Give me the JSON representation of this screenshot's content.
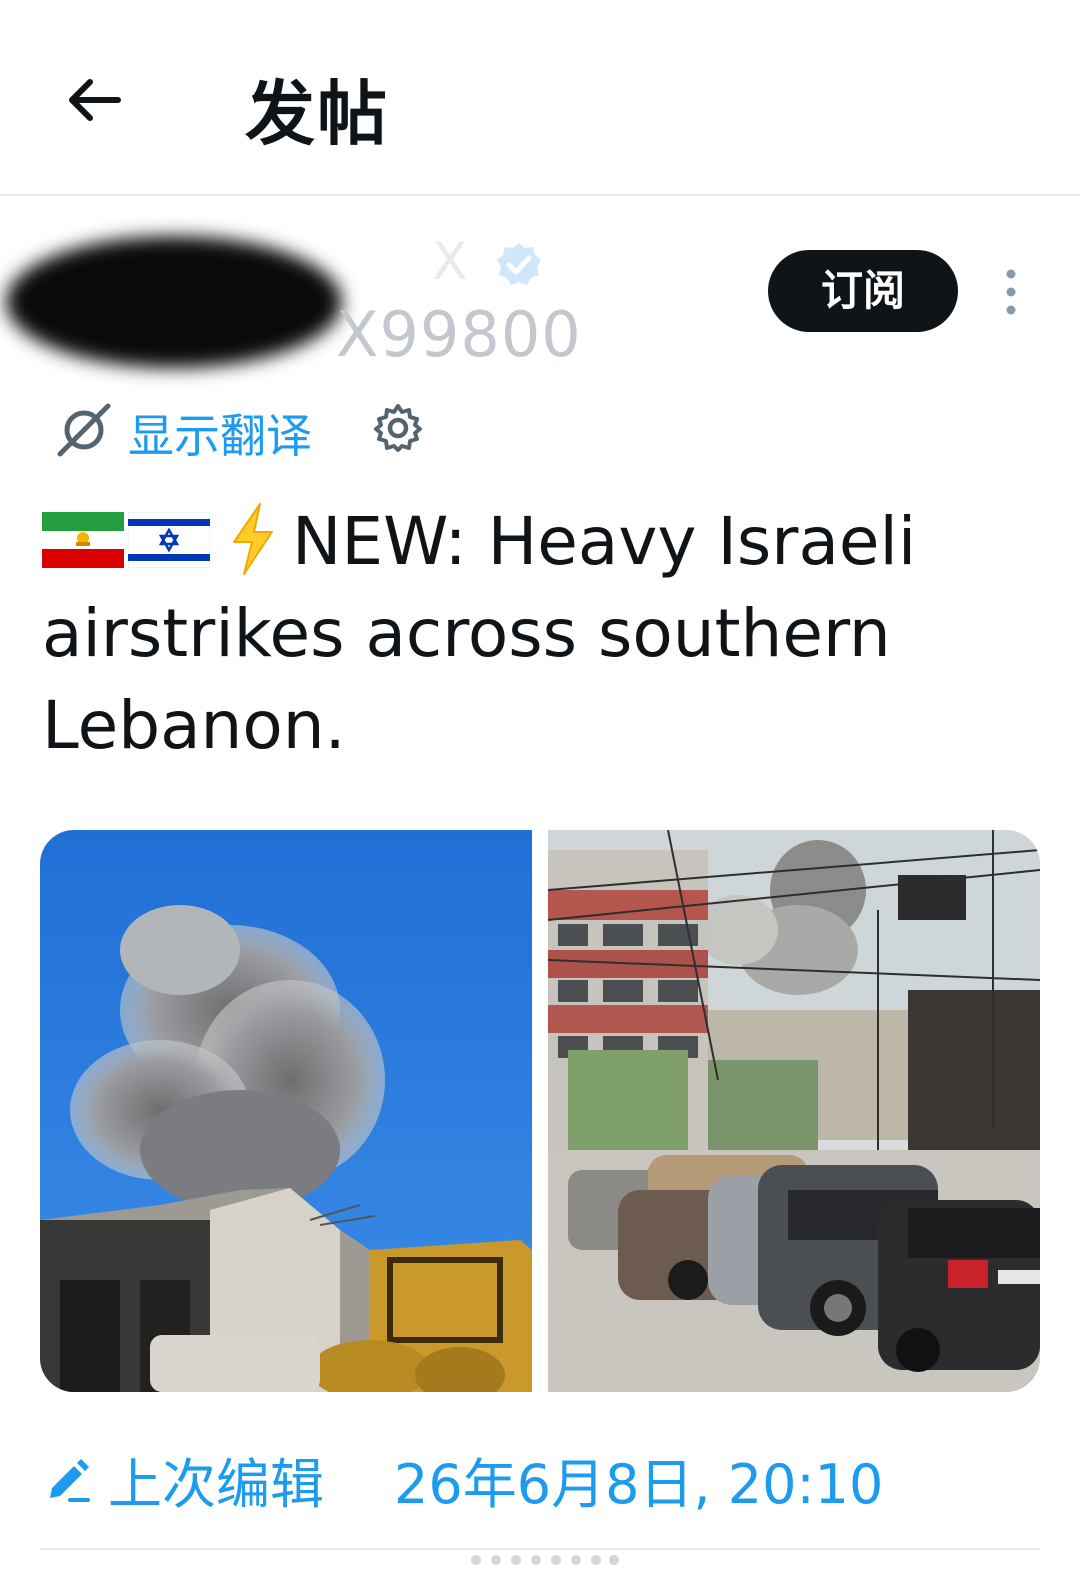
{
  "header": {
    "title": "发帖"
  },
  "author": {
    "name_visible_fragment": "X",
    "handle_fragment": "X99800",
    "subscribe_label": "订阅"
  },
  "translate": {
    "label": "显示翻译"
  },
  "post": {
    "text": "NEW: Heavy Israeli airstrikes across southern Lebanon."
  },
  "media": {
    "images": [
      {
        "subject": "smoke plume over damaged building, blue sky"
      },
      {
        "subject": "street with parked dusty cars, smoke rising over city"
      }
    ]
  },
  "edited": {
    "label": "上次编辑",
    "date": "26年6月8日, 20:10"
  },
  "colors": {
    "accent": "#1d9bf0",
    "text": "#0f1419",
    "button_bg": "#0f1419"
  }
}
